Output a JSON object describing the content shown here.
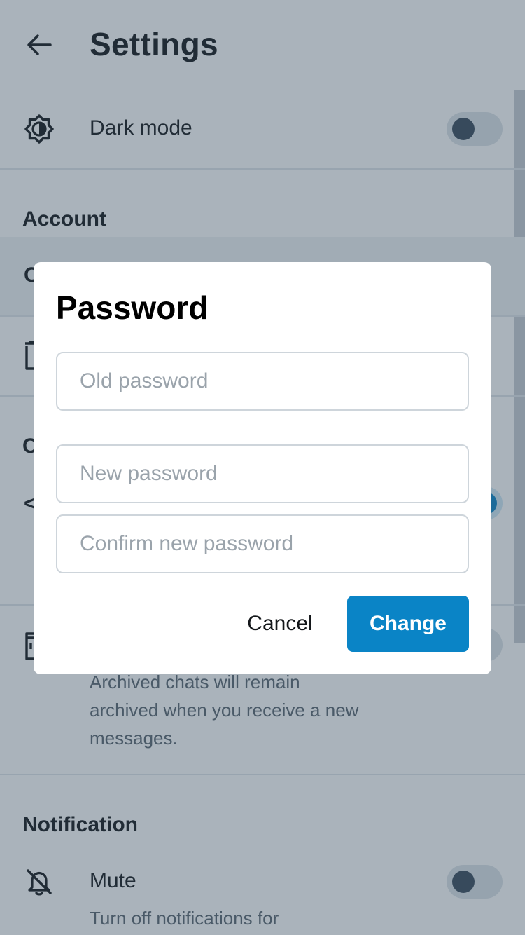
{
  "header": {
    "title": "Settings",
    "back_icon": "arrow-left-icon"
  },
  "appearance": {
    "dark_mode_label": "Dark mode",
    "dark_mode_icon": "brightness-icon",
    "dark_mode_on": false
  },
  "account": {
    "section_title": "Account",
    "partial_item_1_glyph": "C",
    "partial_item_2_icon": "trash-icon"
  },
  "chats": {
    "section_title_partial": "C",
    "partial_item_glyph": "<",
    "partial_toggle_on": true,
    "archive_icon": "archive-icon",
    "archive_toggle_on": false,
    "archive_desc_lines": [
      "Archived chats will remain",
      "archived when you receive a new",
      "messages."
    ]
  },
  "notification": {
    "section_title": "Notification",
    "mute_label": "Mute",
    "mute_icon": "bell-off-icon",
    "mute_on": false,
    "mute_desc": "Turn off notifications for"
  },
  "dialog": {
    "title": "Password",
    "old_placeholder": "Old password",
    "new_placeholder": "New password",
    "confirm_placeholder": "Confirm new password",
    "cancel_label": "Cancel",
    "change_label": "Change"
  },
  "colors": {
    "accent": "#0a84c6",
    "scrim": "rgba(52,74,94,0.42)"
  }
}
